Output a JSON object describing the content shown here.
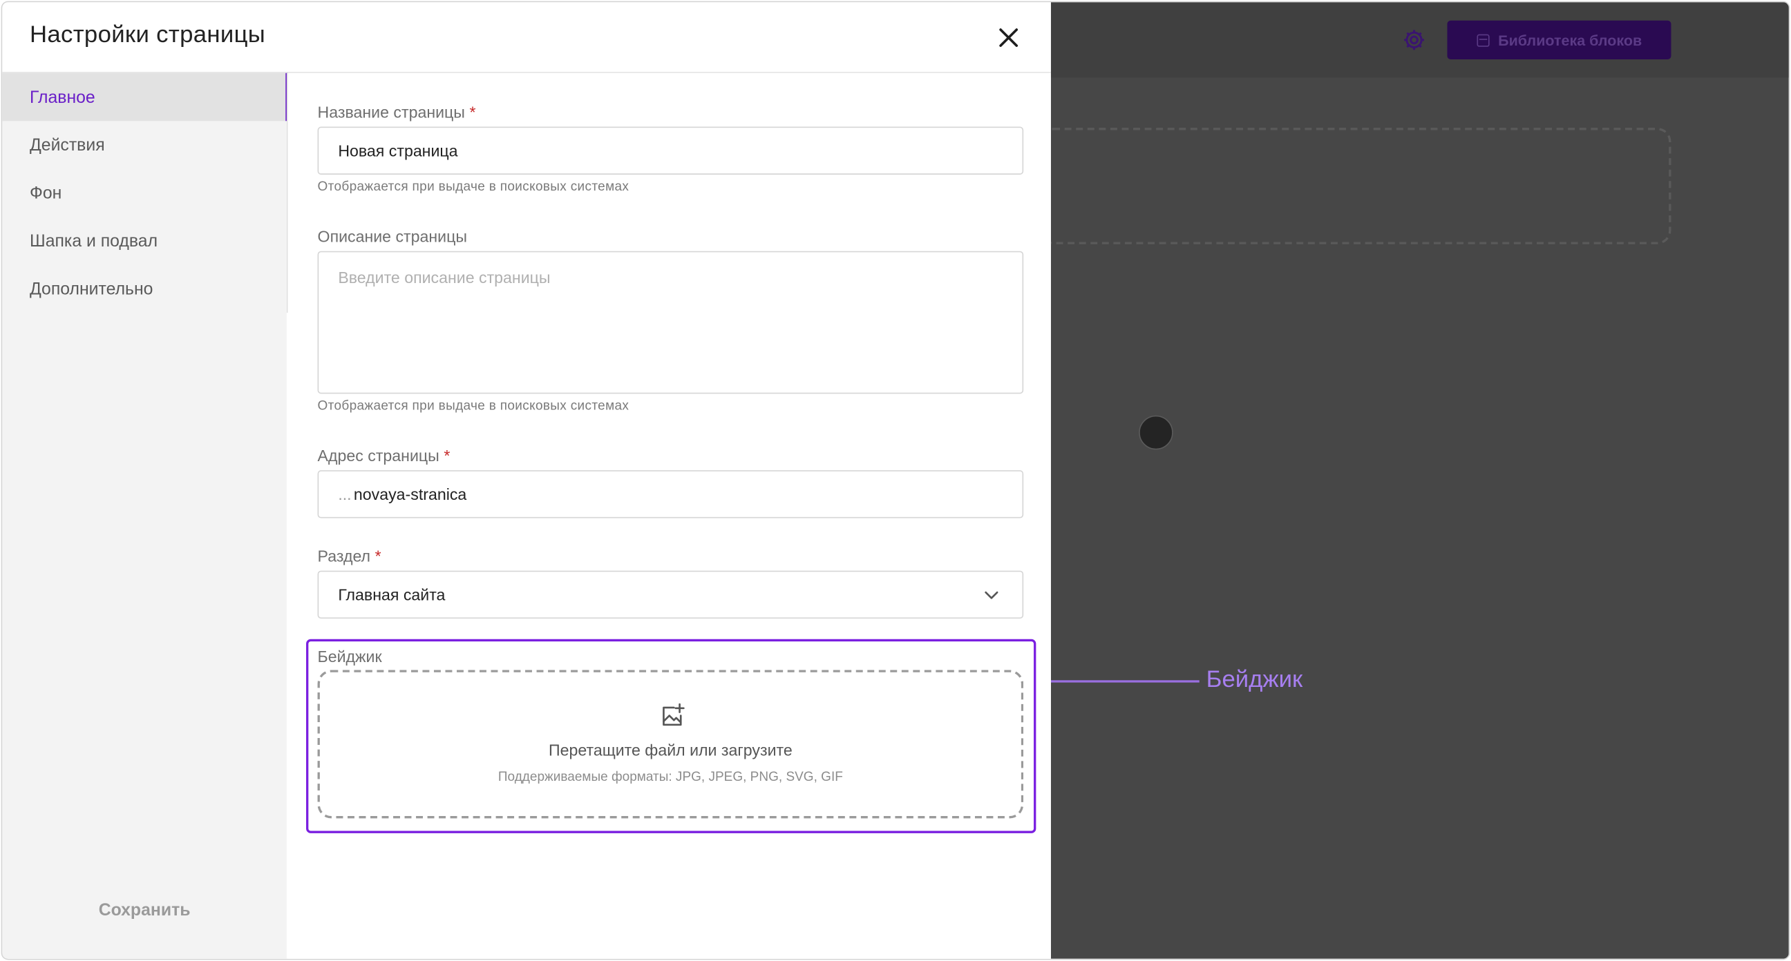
{
  "modal": {
    "title": "Настройки страницы",
    "close_label": "×"
  },
  "sidebar": {
    "items": [
      {
        "label": "Главное",
        "active": true
      },
      {
        "label": "Действия",
        "active": false
      },
      {
        "label": "Фон",
        "active": false
      },
      {
        "label": "Шапка и подвал",
        "active": false
      },
      {
        "label": "Дополнительно",
        "active": false
      }
    ],
    "save_label": "Сохранить"
  },
  "form": {
    "page_name": {
      "label": "Название страницы",
      "required_mark": "*",
      "value": "Новая страница",
      "hint": "Отображается при выдаче в поисковых системах"
    },
    "page_description": {
      "label": "Описание страницы",
      "placeholder": "Введите описание страницы",
      "hint": "Отображается при выдаче в поисковых системах"
    },
    "page_address": {
      "label": "Адрес страницы",
      "required_mark": "*",
      "prefix": "...",
      "value": "novaya-stranica"
    },
    "section": {
      "label": "Раздел",
      "required_mark": "*",
      "value": "Главная сайта"
    },
    "badge": {
      "label": "Бейджик",
      "drop_text": "Перетащите файл или загрузите",
      "formats": "Поддерживаемые форматы: JPG, JPEG, PNG, SVG, GIF"
    }
  },
  "editor": {
    "library_button_label": "Библиотека блоков"
  },
  "annotation": {
    "callout_label": "Бейджик"
  },
  "icons": {
    "settings": "gear-icon",
    "close": "close-icon",
    "dropdown": "chevron-down-icon",
    "upload": "image-add-icon",
    "library": "image-icon"
  },
  "colors": {
    "accent": "#6a1fc8",
    "highlight_border": "#7a1fe0",
    "callout": "#a77ff0",
    "backdrop": "#474747",
    "library_button": "#2a0a52",
    "required": "#c62828"
  }
}
